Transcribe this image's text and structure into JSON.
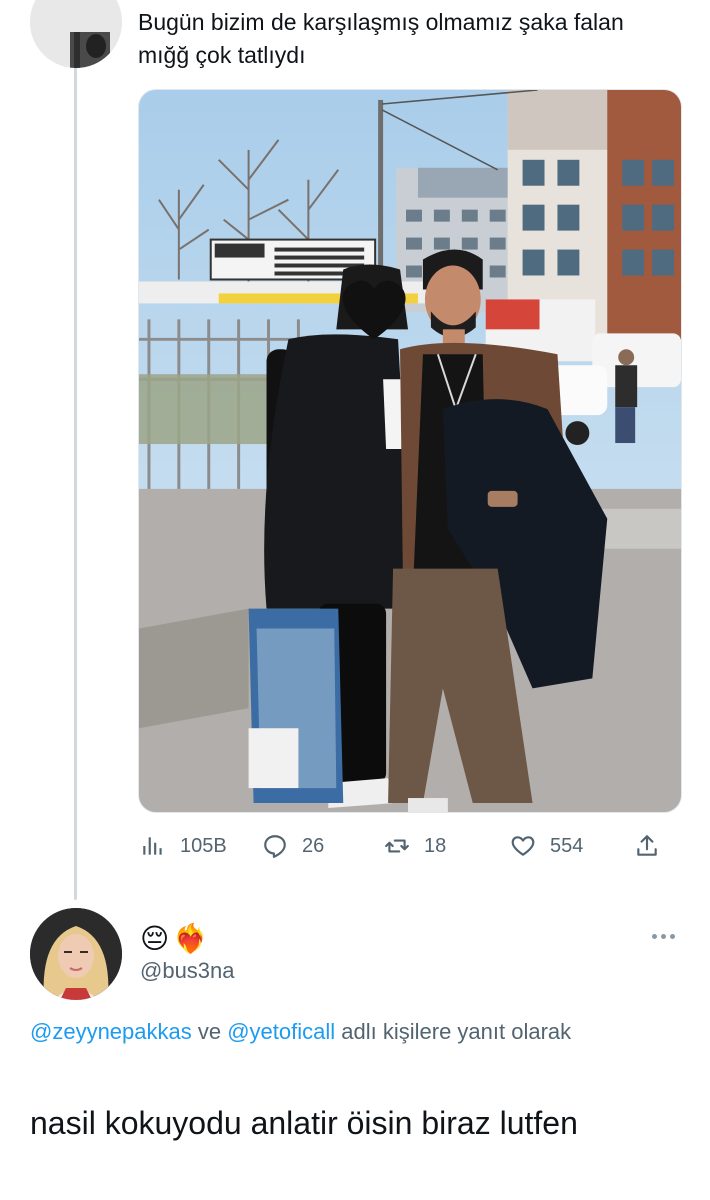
{
  "parent_tweet": {
    "text": "Bugün bizim de karşılaşmış olmamız şaka falan mığğ çok tatlıydı",
    "stats": {
      "views": "105B",
      "replies": "26",
      "retweets": "18",
      "likes": "554"
    }
  },
  "reply_tweet": {
    "display_name_emojis": [
      "😔",
      "❤️‍🔥"
    ],
    "handle": "@bus3na",
    "replying_to_mention_1": "@zeyynepakkas",
    "replying_to_connector": " ve ",
    "replying_to_mention_2": "@yetoficall",
    "replying_to_suffix": " adlı kişilere yanıt olarak",
    "text": "nasil kokuyodu anlatir öisin biraz lutfen"
  },
  "colors": {
    "accent": "#1d9bf0",
    "text_secondary": "#536471",
    "thread_line": "#cfd9de"
  }
}
